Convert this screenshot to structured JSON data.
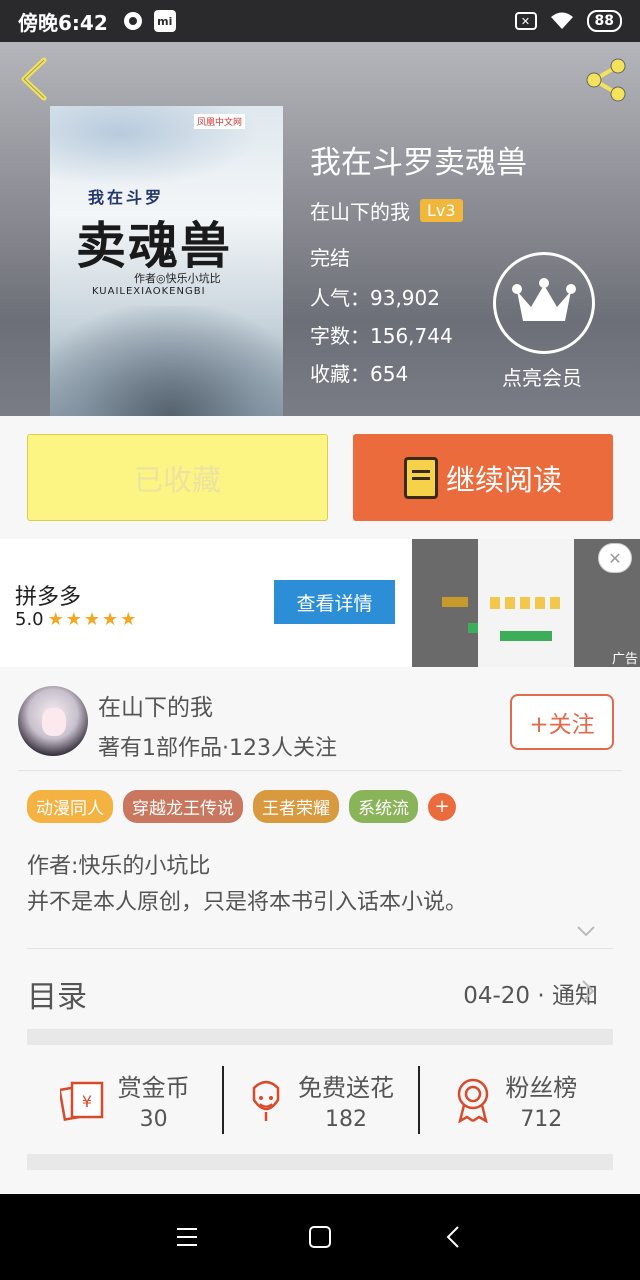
{
  "status_bar": {
    "time": "傍晚6:42",
    "battery": "88",
    "mi_label": "mi"
  },
  "cover": {
    "publisher": "凤凰中文网",
    "subtitle": "我在斗罗",
    "title": "卖魂兽",
    "author_line": "作者◎快乐小坑比",
    "pinyin": "KUAILEXIAOKENGBI"
  },
  "book": {
    "title": "我在斗罗卖魂兽",
    "author": "在山下的我",
    "author_level": "Lv3",
    "status": "完结",
    "popularity": "人气：93,902",
    "word_count": "字数：156,744",
    "favorites": "收藏：654"
  },
  "vip": {
    "label": "点亮会员"
  },
  "actions": {
    "collected_label": "已收藏",
    "continue_label": "继续阅读"
  },
  "ad": {
    "name": "拼多多",
    "rating": "5.0",
    "stars": "★★★★★",
    "button": "查看详情",
    "close": "✕",
    "ad_label": "广告"
  },
  "author_card": {
    "name": "在山下的我",
    "desc": "著有1部作品·123人关注",
    "follow": "+关注"
  },
  "tags": [
    {
      "label": "动漫同人",
      "color": "#f4b243"
    },
    {
      "label": "穿越龙王传说",
      "color": "#c9775e"
    },
    {
      "label": "王者荣耀",
      "color": "#d9993f"
    },
    {
      "label": "系统流",
      "color": "#8ab45a"
    }
  ],
  "tag_more": "+",
  "intro": {
    "line1": "作者:快乐的小坑比",
    "line2": "并不是本人原创，只是将本书引入话本小说。"
  },
  "toc": {
    "title": "目录",
    "update": "04-20 · 通知"
  },
  "stats": [
    {
      "label": "赏金币",
      "value": "30"
    },
    {
      "label": "免费送花",
      "value": "182"
    },
    {
      "label": "粉丝榜",
      "value": "712"
    }
  ],
  "colors": {
    "accent": "#eb6b3c",
    "collect_bg": "#fcf584",
    "vip_gold": "#f0b73c",
    "icon_red": "#d84a2c"
  }
}
